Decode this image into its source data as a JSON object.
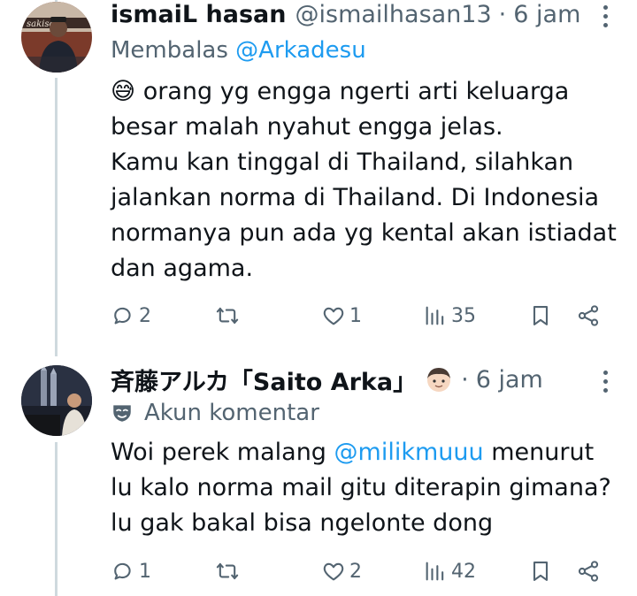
{
  "tweets": [
    {
      "name": "ismaiL hasan",
      "handle": "@ismailhasan13",
      "separator": "·",
      "time": "6 jam",
      "reply_prefix": "Membalas",
      "reply_mention": "@Arkadesu",
      "body_emoji": "😅",
      "body_lines": [
        "orang yg engga ngerti arti keluarga besar malah nyahut engga jelas.",
        "Kamu kan tinggal di Thailand, silahkan jalankan norma di Thailand. Di Indonesia normanya pun ada yg kental akan istiadat dan agama."
      ],
      "stats": {
        "replies": "2",
        "retweets": "",
        "likes": "1",
        "views": "35"
      },
      "icons": [
        "reply-icon",
        "retweet-icon",
        "like-icon",
        "views-icon",
        "bookmark-icon",
        "share-icon"
      ]
    },
    {
      "name": "斉藤アルカ「Saito Arka」",
      "name_emoji": "👦🏻",
      "separator": "·",
      "time": "6 jam",
      "label_icon": "mask-icon",
      "label": "Akun komentar",
      "body_before": "Woi perek malang ",
      "body_mention": "@milikmuuu",
      "body_after": " menurut lu kalo norma mail gitu diterapin gimana? lu gak bakal bisa ngelonte dong",
      "stats": {
        "replies": "1",
        "retweets": "",
        "likes": "2",
        "views": "42"
      },
      "icons": [
        "reply-icon",
        "retweet-icon",
        "like-icon",
        "views-icon",
        "bookmark-icon",
        "share-icon"
      ]
    }
  ],
  "colors": {
    "text": "#0f1419",
    "muted": "#536471",
    "link": "#1d9bf0",
    "thread_line": "#cfd9de"
  }
}
